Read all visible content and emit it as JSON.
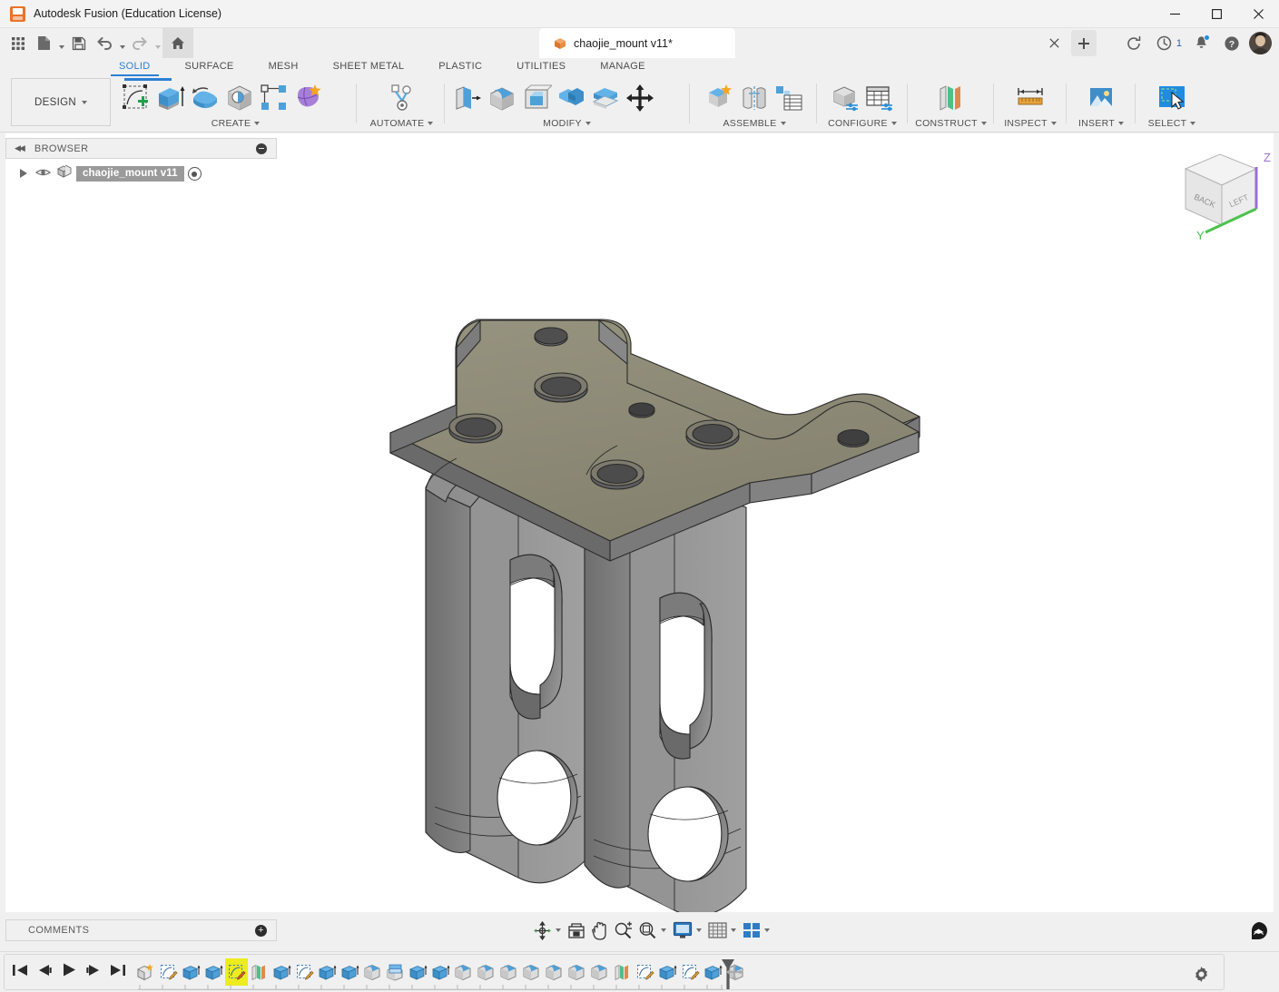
{
  "window": {
    "title": "Autodesk Fusion (Education License)",
    "app_icon": "fusion-logo-icon",
    "minimize": "—",
    "maximize": "□",
    "close": "✕"
  },
  "quick_access": {
    "items": [
      {
        "name": "app-grid-icon",
        "label": "Grid"
      },
      {
        "name": "new-file-icon",
        "label": "New"
      },
      {
        "name": "save-icon",
        "label": "Save"
      },
      {
        "name": "undo-icon",
        "label": "Undo"
      },
      {
        "name": "redo-icon",
        "label": "Redo"
      },
      {
        "name": "home-icon",
        "label": "Home"
      }
    ]
  },
  "document_tab": {
    "label": "chaojie_mount v11*",
    "icon": "orange-cube-icon",
    "close_label": "✕",
    "new_tab_label": "+"
  },
  "header_icons": [
    {
      "name": "refresh-icon",
      "label": "Refresh"
    },
    {
      "name": "job-status-icon",
      "label": "Job status",
      "count": "1"
    },
    {
      "name": "notifications-bell-icon",
      "label": "Notifications",
      "badge": true
    },
    {
      "name": "help-icon",
      "label": "Help"
    },
    {
      "name": "user-avatar",
      "label": "Account"
    }
  ],
  "workspace": {
    "label": "DESIGN",
    "caret": "▾"
  },
  "ribbon": {
    "tabs": [
      {
        "label": "SOLID",
        "active": true
      },
      {
        "label": "SURFACE",
        "active": false
      },
      {
        "label": "MESH",
        "active": false
      },
      {
        "label": "SHEET METAL",
        "active": false
      },
      {
        "label": "PLASTIC",
        "active": false
      },
      {
        "label": "UTILITIES",
        "active": false
      },
      {
        "label": "MANAGE",
        "active": false
      }
    ],
    "panels": [
      {
        "label": "CREATE",
        "has_caret": true,
        "tools": [
          {
            "name": "create-sketch-icon",
            "label": "Create Sketch"
          },
          {
            "name": "extrude-icon",
            "label": "Extrude"
          },
          {
            "name": "revolve-icon",
            "label": "Revolve"
          },
          {
            "name": "hole-icon",
            "label": "Hole"
          },
          {
            "name": "pattern-icon",
            "label": "Rectangular Pattern"
          },
          {
            "name": "create-form-icon",
            "label": "Create Form"
          }
        ]
      },
      {
        "label": "AUTOMATE",
        "has_caret": true,
        "tools": [
          {
            "name": "automate-icon",
            "label": "Automated Modeling"
          }
        ]
      },
      {
        "label": "MODIFY",
        "has_caret": true,
        "tools": [
          {
            "name": "press-pull-icon",
            "label": "Press Pull"
          },
          {
            "name": "fillet-icon",
            "label": "Fillet"
          },
          {
            "name": "shell-icon",
            "label": "Shell"
          },
          {
            "name": "combine-icon",
            "label": "Combine"
          },
          {
            "name": "offset-face-icon",
            "label": "Offset Face"
          },
          {
            "name": "move-copy-icon",
            "label": "Move/Copy"
          }
        ]
      },
      {
        "label": "ASSEMBLE",
        "has_caret": true,
        "tools": [
          {
            "name": "new-component-icon",
            "label": "New Component"
          },
          {
            "name": "joint-icon",
            "label": "Joint"
          },
          {
            "name": "bom-table-icon",
            "label": "Bill of Materials"
          }
        ]
      },
      {
        "label": "CONFIGURE",
        "has_caret": true,
        "tools": [
          {
            "name": "configure-design-icon",
            "label": "Configure Design"
          },
          {
            "name": "configuration-table-icon",
            "label": "Configuration Table"
          }
        ]
      },
      {
        "label": "CONSTRUCT",
        "has_caret": true,
        "tools": [
          {
            "name": "construction-plane-icon",
            "label": "Offset Plane"
          }
        ]
      },
      {
        "label": "INSPECT",
        "has_caret": true,
        "tools": [
          {
            "name": "measure-ruler-icon",
            "label": "Measure"
          }
        ]
      },
      {
        "label": "INSERT",
        "has_caret": true,
        "tools": [
          {
            "name": "insert-image-icon",
            "label": "Insert"
          }
        ]
      },
      {
        "label": "SELECT",
        "has_caret": true,
        "tools": [
          {
            "name": "select-cursor-icon",
            "label": "Select"
          }
        ]
      }
    ]
  },
  "browser": {
    "title": "BROWSER",
    "collapse_icon": "collapse-left-icon",
    "minimize_icon": "minus-circle-icon",
    "items": [
      {
        "label": "chaojie_mount v11",
        "expand_icon": "expand-triangle-icon",
        "visibility_icon": "eye-icon",
        "component_icon": "component-icon",
        "selected": true
      }
    ]
  },
  "comments": {
    "title": "COMMENTS",
    "add_icon": "plus-circle-icon"
  },
  "navigation_bar": {
    "tools": [
      {
        "name": "orbit-icon",
        "label": "Orbit",
        "caret": true
      },
      {
        "name": "fit-view-icon",
        "label": "Fit",
        "caret": false
      },
      {
        "name": "pan-hand-icon",
        "label": "Pan",
        "caret": false
      },
      {
        "name": "zoom-magnifier-icon",
        "label": "Zoom",
        "caret": false
      },
      {
        "name": "zoom-window-icon",
        "label": "Zoom Window",
        "caret": true
      },
      {
        "name": "display-settings-icon",
        "label": "Display Settings",
        "caret": true
      },
      {
        "name": "grid-snaps-icon",
        "label": "Grid and Snaps",
        "caret": true
      },
      {
        "name": "viewports-icon",
        "label": "Viewports",
        "caret": true
      }
    ]
  },
  "view_cube": {
    "faces": [
      "BACK",
      "LEFT"
    ],
    "axes": [
      {
        "label": "Z",
        "color": "#9b6fd4"
      },
      {
        "label": "Y",
        "color": "#4cc24c"
      }
    ]
  },
  "timeline": {
    "playback": [
      {
        "name": "go-to-start-icon",
        "label": "Go to beginning"
      },
      {
        "name": "step-back-icon",
        "label": "Step back"
      },
      {
        "name": "play-icon",
        "label": "Play"
      },
      {
        "name": "step-forward-icon",
        "label": "Step forward"
      },
      {
        "name": "go-to-end-icon",
        "label": "Go to end"
      }
    ],
    "features": [
      {
        "name": "timeline-feature-new-component",
        "type": "component",
        "highlighted": false
      },
      {
        "name": "timeline-feature-sketch",
        "type": "sketch",
        "highlighted": false
      },
      {
        "name": "timeline-feature-extrude",
        "type": "extrude",
        "highlighted": false
      },
      {
        "name": "timeline-feature-extrude",
        "type": "extrude",
        "highlighted": false
      },
      {
        "name": "timeline-feature-sketch",
        "type": "sketch",
        "highlighted": true
      },
      {
        "name": "timeline-feature-plane",
        "type": "plane",
        "highlighted": false
      },
      {
        "name": "timeline-feature-extrude",
        "type": "extrude",
        "highlighted": false
      },
      {
        "name": "timeline-feature-sketch",
        "type": "sketch",
        "highlighted": false
      },
      {
        "name": "timeline-feature-extrude",
        "type": "extrude",
        "highlighted": false
      },
      {
        "name": "timeline-feature-extrude",
        "type": "extrude",
        "highlighted": false
      },
      {
        "name": "timeline-feature-fillet",
        "type": "fillet",
        "highlighted": false
      },
      {
        "name": "timeline-feature-shell",
        "type": "shell",
        "highlighted": false
      },
      {
        "name": "timeline-feature-extrude",
        "type": "extrude",
        "highlighted": false
      },
      {
        "name": "timeline-feature-extrude",
        "type": "extrude",
        "highlighted": false
      },
      {
        "name": "timeline-feature-fillet",
        "type": "fillet",
        "highlighted": false
      },
      {
        "name": "timeline-feature-fillet",
        "type": "fillet",
        "highlighted": false
      },
      {
        "name": "timeline-feature-fillet",
        "type": "fillet",
        "highlighted": false
      },
      {
        "name": "timeline-feature-fillet",
        "type": "fillet",
        "highlighted": false
      },
      {
        "name": "timeline-feature-fillet",
        "type": "fillet",
        "highlighted": false
      },
      {
        "name": "timeline-feature-fillet",
        "type": "fillet",
        "highlighted": false
      },
      {
        "name": "timeline-feature-fillet",
        "type": "fillet",
        "highlighted": false
      },
      {
        "name": "timeline-feature-plane",
        "type": "plane",
        "highlighted": false
      },
      {
        "name": "timeline-feature-sketch",
        "type": "sketch",
        "highlighted": false
      },
      {
        "name": "timeline-feature-extrude",
        "type": "extrude",
        "highlighted": false
      },
      {
        "name": "timeline-feature-sketch",
        "type": "sketch",
        "highlighted": false
      },
      {
        "name": "timeline-feature-extrude",
        "type": "extrude",
        "highlighted": false
      },
      {
        "name": "timeline-feature-fillet",
        "type": "fillet",
        "highlighted": false
      }
    ],
    "playhead": "timeline-playhead-marker",
    "settings_icon": "gear-icon"
  },
  "model": {
    "name": "chaojie_mount",
    "description": "T-shaped mounting bracket with top flange plate and two vertical legs",
    "colors": {
      "top_face": "#8d8a7e",
      "front_face": "#8e8e8e",
      "side_face": "#6f6f6f",
      "edge": "#2e2e2e",
      "background": "#ffffff"
    }
  },
  "theme": {
    "accent": "#2b7fd4",
    "ribbon_bg": "#f0f0f0",
    "canvas_bg": "#ffffff",
    "highlight": "#ecec1e",
    "orange": "#e8732a"
  }
}
